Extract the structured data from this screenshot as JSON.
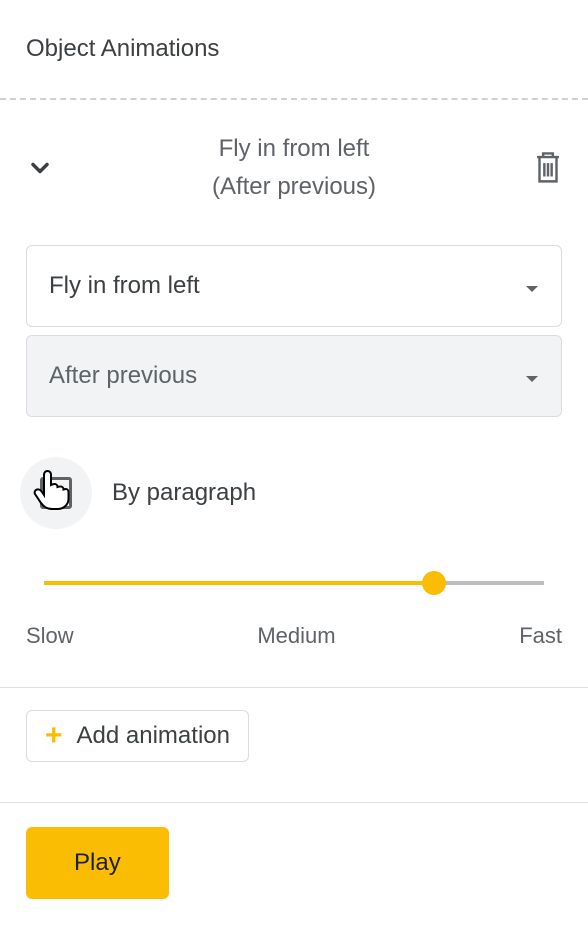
{
  "panel": {
    "title": "Object Animations"
  },
  "animation": {
    "header_line1": "Fly in from left",
    "header_line2": "(After previous)",
    "type_dropdown": "Fly in from left",
    "trigger_dropdown": "After previous",
    "by_paragraph_label": "By paragraph",
    "speed_slider": {
      "slow": "Slow",
      "medium": "Medium",
      "fast": "Fast",
      "value_percent": 78
    }
  },
  "buttons": {
    "add_animation": "Add animation",
    "play": "Play"
  }
}
